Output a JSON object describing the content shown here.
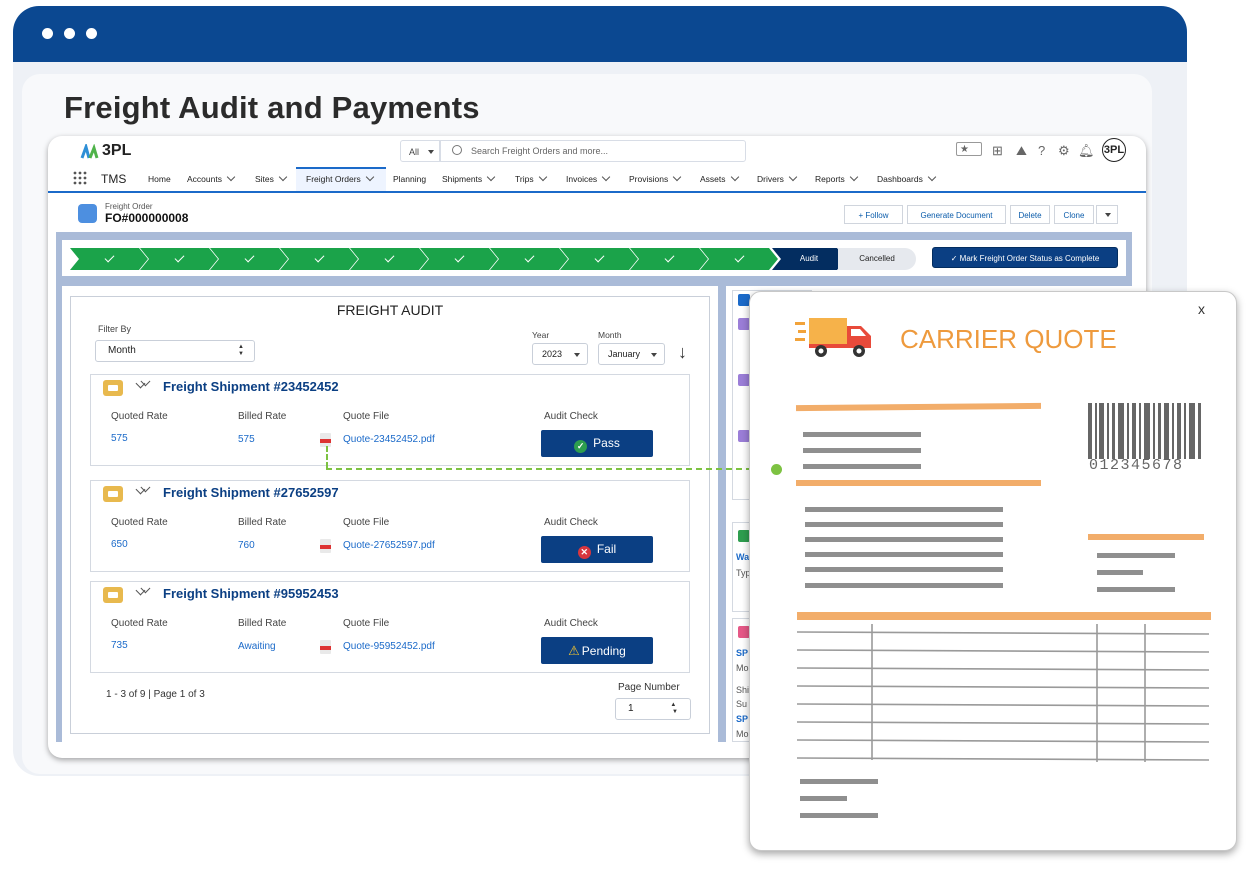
{
  "page": {
    "heading": "Freight Audit and Payments"
  },
  "app": {
    "logo": "3PL",
    "search": {
      "scope": "All",
      "placeholder": "Search Freight Orders and more..."
    },
    "avatar": "3PL",
    "app_name": "TMS",
    "nav": [
      {
        "label": "Home",
        "dropdown": false
      },
      {
        "label": "Accounts",
        "dropdown": true
      },
      {
        "label": "Sites",
        "dropdown": true
      },
      {
        "label": "Freight Orders",
        "dropdown": true,
        "active": true
      },
      {
        "label": "Planning",
        "dropdown": false
      },
      {
        "label": "Shipments",
        "dropdown": true
      },
      {
        "label": "Trips",
        "dropdown": true
      },
      {
        "label": "Invoices",
        "dropdown": true
      },
      {
        "label": "Provisions",
        "dropdown": true
      },
      {
        "label": "Assets",
        "dropdown": true
      },
      {
        "label": "Drivers",
        "dropdown": true
      },
      {
        "label": "Reports",
        "dropdown": true
      },
      {
        "label": "Dashboards",
        "dropdown": true
      }
    ]
  },
  "record": {
    "object_label": "Freight Order",
    "number": "FO#000000008",
    "actions": {
      "follow": "+ Follow",
      "generate": "Generate Document",
      "delete": "Delete",
      "clone": "Clone"
    }
  },
  "path": {
    "completed_steps": 10,
    "current": "Audit",
    "next": "Cancelled",
    "mark_complete": "Mark Freight Order Status as Complete"
  },
  "audit": {
    "title": "FREIGHT AUDIT",
    "filter_label": "Filter By",
    "filter_value": "Month",
    "year_label": "Year",
    "year_value": "2023",
    "month_label": "Month",
    "month_value": "January",
    "columns": {
      "quoted": "Quoted Rate",
      "billed": "Billed Rate",
      "file": "Quote File",
      "check": "Audit Check"
    },
    "shipments": [
      {
        "title": "Freight Shipment #23452452",
        "quoted": "575",
        "billed": "575",
        "file": "Quote-23452452.pdf",
        "status": "Pass"
      },
      {
        "title": "Freight Shipment #27652597",
        "quoted": "650",
        "billed": "760",
        "file": "Quote-27652597.pdf",
        "status": "Fail"
      },
      {
        "title": "Freight Shipment #95952453",
        "quoted": "735",
        "billed": "Awaiting",
        "file": "Quote-95952452.pdf",
        "status": "Pending"
      }
    ],
    "pager": "1 - 3 of 9 | Page 1 of 3",
    "page_number_label": "Page Number",
    "page_number_value": "1"
  },
  "side": {
    "items": [
      "Wa",
      "Typ",
      "SP",
      "Mo",
      "Shi",
      "Su",
      "SP",
      "Mo"
    ]
  },
  "quote": {
    "close": "x",
    "title": "CARRIER QUOTE",
    "barcode_number": "012345678"
  }
}
